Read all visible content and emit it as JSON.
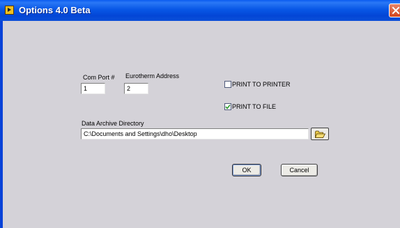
{
  "window": {
    "title": "Options  4.0 Beta"
  },
  "form": {
    "com_port": {
      "label": "Com Port #",
      "value": "1"
    },
    "eurotherm_address": {
      "label": "Eurotherm Address",
      "value": "2"
    },
    "print_to_printer": {
      "label": "PRINT TO PRINTER",
      "checked": false
    },
    "print_to_file": {
      "label": "PRINT TO FILE",
      "checked": true
    },
    "data_archive": {
      "label": "Data Archive Directory",
      "value": "C:\\Documents and Settings\\dho\\Desktop"
    }
  },
  "buttons": {
    "ok_label": "OK",
    "cancel_label": "Cancel"
  },
  "icons": {
    "app": "labview-app-icon",
    "close": "close-icon",
    "browse": "folder-open-icon",
    "check": "checkmark-icon"
  },
  "colors": {
    "titlebar": "#0857e6",
    "client_bg": "#d4d2d8",
    "close": "#d4441c",
    "check": "#2a9a2a"
  }
}
